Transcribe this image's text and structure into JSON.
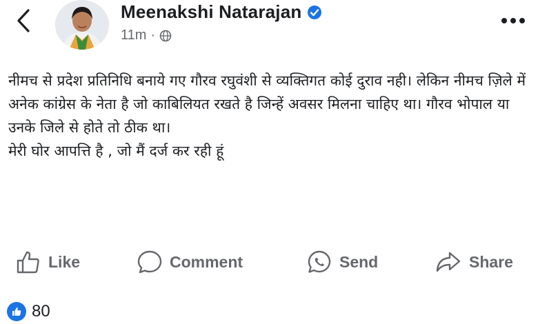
{
  "post": {
    "author": "Meenakshi Natarajan",
    "time": "11m",
    "separator": "·",
    "paragraph_1": "नीमच से प्रदेश प्रतिनिधि बनाये गए गौरव रघुवंशी से व्यक्तिगत कोई दुराव नही। लेकिन नीमच ज़िले में अनेक कांग्रेस के नेता है जो काबिलियत रखते है जिन्हें अवसर मिलना चाहिए था। गौरव भोपाल या उनके जिले से होते तो ठीक था।",
    "paragraph_2": "मेरी घोर आपत्ति है , जो मैं दर्ज कर रही हूं"
  },
  "actions": {
    "like": "Like",
    "comment": "Comment",
    "send": "Send",
    "share": "Share"
  },
  "reactions": {
    "count": "80"
  },
  "colors": {
    "accent": "#1b74e4",
    "secondary_text": "#65676b"
  },
  "icons": [
    "back-icon",
    "verified-icon",
    "globe-icon",
    "more-icon",
    "like-icon",
    "comment-icon",
    "send-icon",
    "share-icon",
    "like-reaction-icon"
  ]
}
